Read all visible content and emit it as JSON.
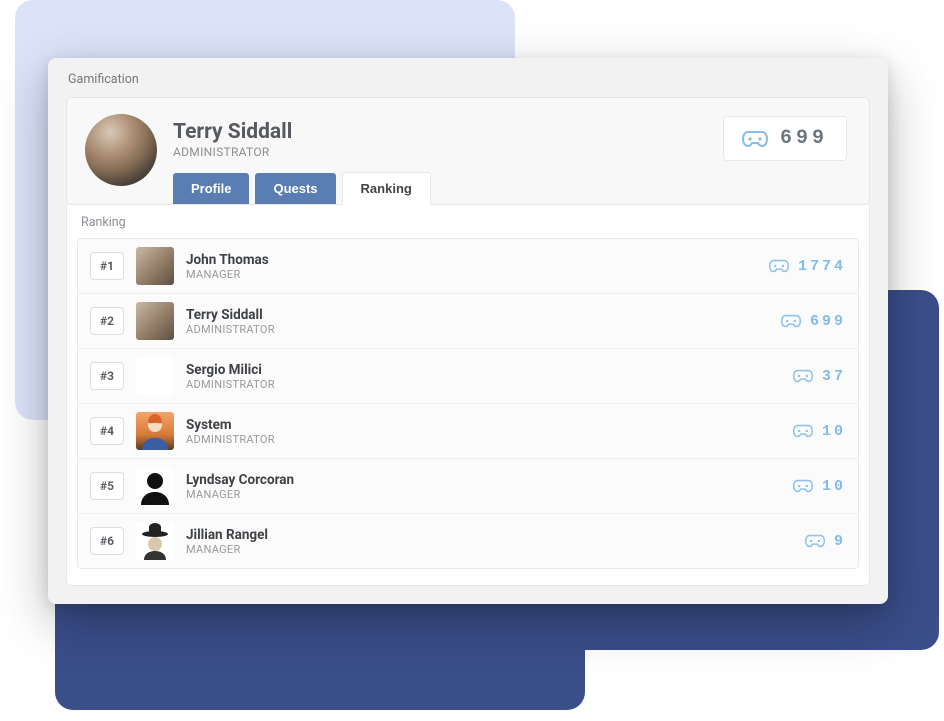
{
  "window": {
    "title": "Gamification"
  },
  "profile": {
    "name": "Terry Siddall",
    "role": "ADMINISTRATOR",
    "score": "699"
  },
  "tabs": {
    "profile": "Profile",
    "quests": "Quests",
    "ranking": "Ranking"
  },
  "ranking": {
    "heading": "Ranking",
    "rows": [
      {
        "rank": "#1",
        "name": "John Thomas",
        "role": "MANAGER",
        "score": "1774",
        "avatar": "photo1"
      },
      {
        "rank": "#2",
        "name": "Terry Siddall",
        "role": "ADMINISTRATOR",
        "score": "699",
        "avatar": "photo2"
      },
      {
        "rank": "#3",
        "name": "Sergio Milici",
        "role": "ADMINISTRATOR",
        "score": "37",
        "avatar": "photo3"
      },
      {
        "rank": "#4",
        "name": "System",
        "role": "ADMINISTRATOR",
        "score": "10",
        "avatar": "robot"
      },
      {
        "rank": "#5",
        "name": "Lyndsay Corcoran",
        "role": "MANAGER",
        "score": "10",
        "avatar": "silhouette"
      },
      {
        "rank": "#6",
        "name": "Jillian Rangel",
        "role": "MANAGER",
        "score": "9",
        "avatar": "hat"
      }
    ]
  }
}
